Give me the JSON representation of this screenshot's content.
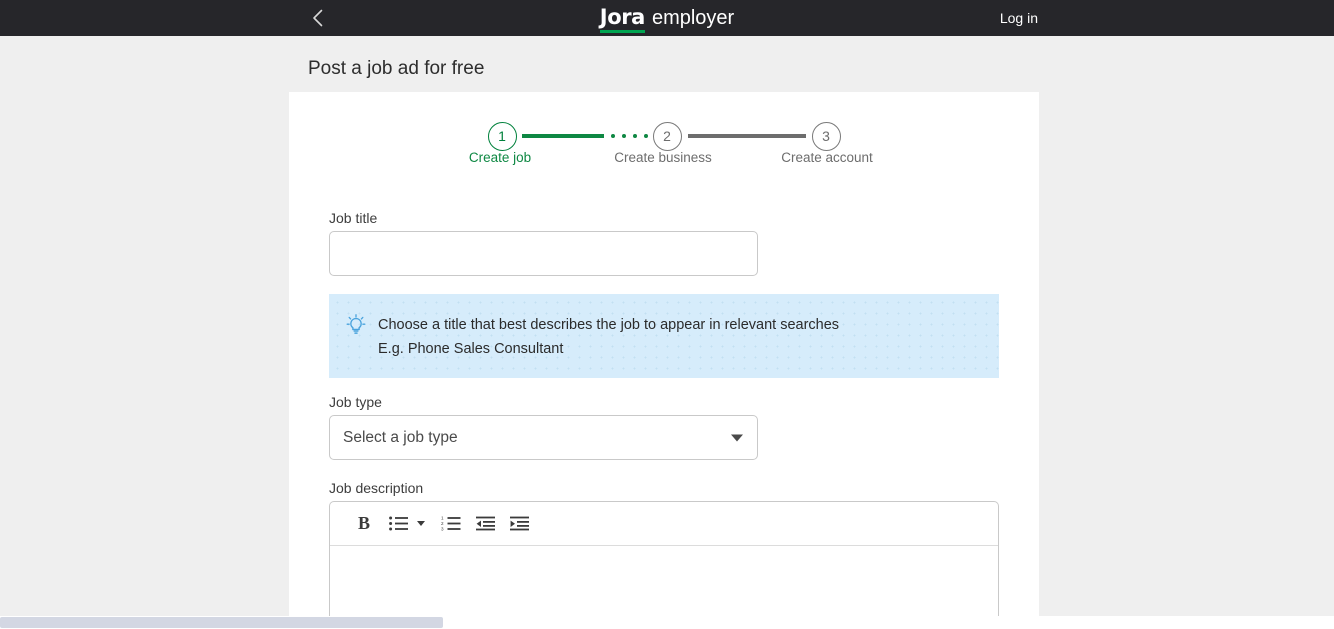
{
  "header": {
    "back_icon": "chevron-left-icon",
    "brand_primary": "Jora",
    "brand_secondary": "employer",
    "login_label": "Log in",
    "bg_color": "#26262a",
    "accent_color": "#00a451"
  },
  "page": {
    "title": "Post a job ad for free",
    "background": "#efefef",
    "card_background": "#ffffff"
  },
  "stepper": {
    "active_color": "#0e8843",
    "inactive_color": "#6d6d6d",
    "steps": [
      {
        "number": "1",
        "label": "Create job",
        "state": "active"
      },
      {
        "number": "2",
        "label": "Create business",
        "state": "inactive"
      },
      {
        "number": "3",
        "label": "Create account",
        "state": "inactive"
      }
    ],
    "connector_dots": 4
  },
  "form": {
    "job_title": {
      "label": "Job title",
      "value": "",
      "placeholder": ""
    },
    "tip": {
      "icon": "lightbulb-icon",
      "line1": "Choose a title that best describes the job to appear in relevant searches",
      "line2": "E.g. Phone Sales Consultant",
      "background": "#d6ecfb"
    },
    "job_type": {
      "label": "Job type",
      "selected": "Select a job type",
      "caret_icon": "chevron-down-icon"
    },
    "job_description": {
      "label": "Job description",
      "value": "",
      "toolbar": [
        {
          "name": "bold-button",
          "glyph": "B"
        },
        {
          "name": "bullet-list-button",
          "glyph": "bullet-list-icon"
        },
        {
          "name": "bullet-list-dropdown",
          "glyph": "chevron-down-icon"
        },
        {
          "name": "numbered-list-button",
          "glyph": "numbered-list-icon"
        },
        {
          "name": "outdent-button",
          "glyph": "outdent-icon"
        },
        {
          "name": "indent-button",
          "glyph": "indent-icon"
        }
      ]
    }
  },
  "scrollbar": {
    "orientation": "horizontal",
    "thumb_color": "#d3d7e3"
  }
}
